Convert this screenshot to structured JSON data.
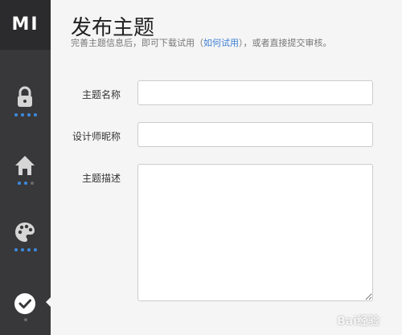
{
  "brand": {
    "logo_text": "MI"
  },
  "page": {
    "title": "发布主题",
    "subtitle_before": "完善主题信息后，即可下载试用（",
    "subtitle_link": "如何试用",
    "subtitle_after": "），或者直接提交审核。"
  },
  "form": {
    "name_label": "主题名称",
    "name_value": "",
    "designer_label": "设计师昵称",
    "designer_value": "",
    "description_label": "主题描述",
    "description_value": ""
  },
  "sidebar": {
    "items": [
      {
        "icon": "lock-icon",
        "active": false
      },
      {
        "icon": "home-icon",
        "active": false
      },
      {
        "icon": "palette-icon",
        "active": false
      },
      {
        "icon": "checkmark-circle-icon",
        "active": true
      }
    ]
  },
  "colors": {
    "sidebar_bg": "#38383a",
    "accent": "#3d8be0",
    "link": "#3d7fd4"
  },
  "watermark": {
    "text": "Bai经验"
  }
}
